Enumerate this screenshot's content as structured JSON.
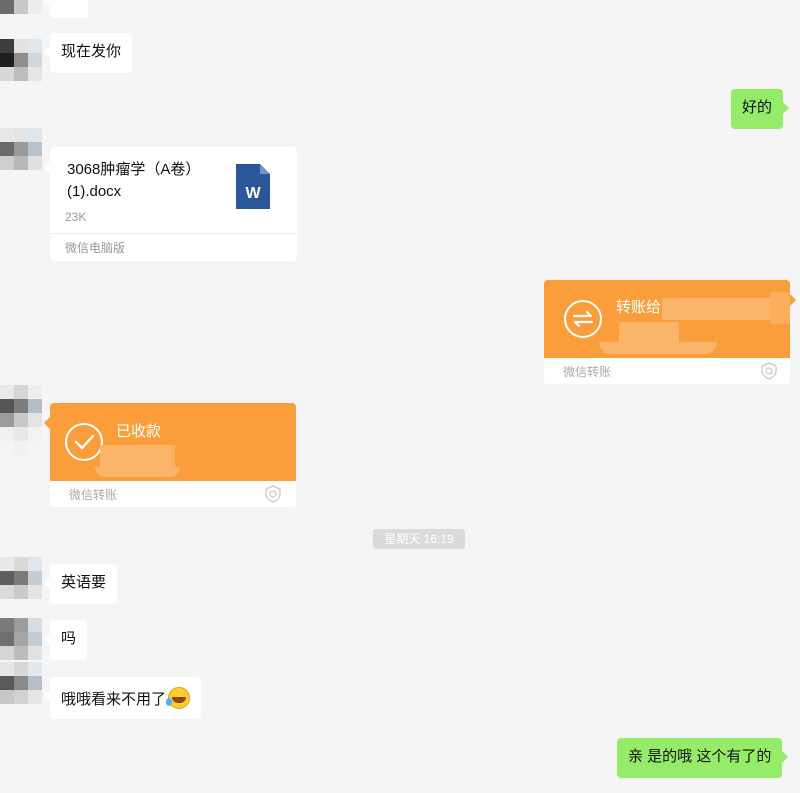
{
  "messages": {
    "top_partial": "",
    "now_send": "现在发你",
    "ok": "好的",
    "english_want": "英语要",
    "ma": "吗",
    "oh_no_need": "哦哦看来不用了",
    "yes_have": "亲 是的哦 这个有了的"
  },
  "file_card": {
    "name": "3068肿瘤学（A卷）(1).docx",
    "size": "23K",
    "source": "微信电脑版",
    "icon": "word-doc-icon"
  },
  "transfer_sent": {
    "title": "转账给",
    "source": "微信转账",
    "icon": "transfer-arrows-icon"
  },
  "transfer_received": {
    "title": "已收款",
    "source": "微信转账",
    "icon": "check-circle-icon"
  },
  "timestamp": "星期天 16:19",
  "colors": {
    "background": "#f5f5f5",
    "self_bubble": "#95ec69",
    "other_bubble": "#ffffff",
    "transfer_orange": "#fa9d3b",
    "word_blue": "#2b579a"
  }
}
